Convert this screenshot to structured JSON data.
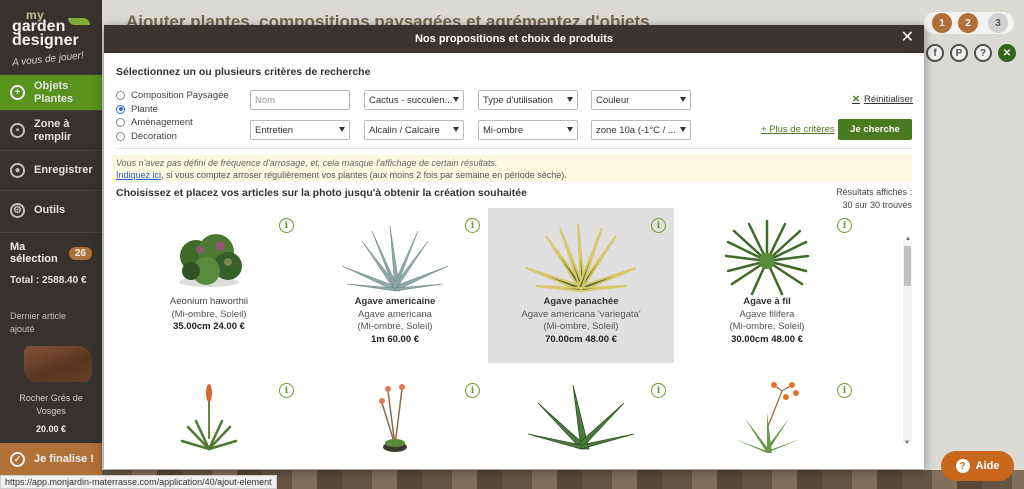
{
  "sidebar": {
    "logo": {
      "line1": "my",
      "line2": "garden",
      "line3": "designer",
      "tagline": "A vous de jouer!"
    },
    "nav": [
      {
        "label": "Objets Plantes",
        "icon": "plus-icon"
      },
      {
        "label": "Zone à remplir",
        "icon": "car-icon"
      },
      {
        "label": "Enregistrer",
        "icon": "save-icon"
      },
      {
        "label": "Outils",
        "icon": "tools-icon"
      }
    ],
    "selection": {
      "label": "Ma sélection",
      "count": "26",
      "total": "Total : 2588.40 €"
    },
    "last_item": {
      "label": "Dernier article ajouté",
      "name": "Rocher Grès de Vosges",
      "price": "20.00 €"
    },
    "finalise": "Je finalise !"
  },
  "page": {
    "title": "Ajouter plantes, compositions paysagées et agrémentez d'objets",
    "steps": [
      "1",
      "2",
      "3"
    ],
    "status_url": "https://app.monjardin-materrasse.com/application/40/ajout-element",
    "aide": "Aide"
  },
  "modal": {
    "title": "Nos propositions et choix de produits",
    "criteria_title": "Sélectionnez un ou plusieurs critères de recherche",
    "radio_options": [
      {
        "label": "Composition Paysagée",
        "checked": false
      },
      {
        "label": "Plante",
        "checked": true
      },
      {
        "label": "Aménagement",
        "checked": false
      },
      {
        "label": "Décoration",
        "checked": false
      }
    ],
    "filters": {
      "nom_placeholder": "Nom",
      "type_plante": "Cactus - succulen...",
      "type_utilisation": "Type d'utilisation",
      "couleur": "Couleur",
      "entretien": "Entretien",
      "sol": "Alcalin / Calcaire",
      "exposition": "Mi-ombre",
      "zone": "zone 10a (-1°C / ..."
    },
    "reset": "Réinitialiser",
    "more_criteria": "+ Plus de critères",
    "search_button": "Je cherche",
    "warning": {
      "line1": "Vous n'avez pas défini de fréquence d'arrosage, et, cela masque l'affichage de certain résultats.",
      "link": "Indiquez ici",
      "line2": ", si vous comptez arroser régulièrement vos plantes (aux moins 2 fois par semaine en période sèche)."
    },
    "choose_title": "Choisissez et placez vos articles sur la photo jusqu'à obtenir la création souhaitée",
    "results": {
      "label": "Résultats affichés :",
      "value": "30 sur 30 trouvés"
    },
    "products": [
      {
        "name": "",
        "latin": "Aeonium haworthii",
        "expo": "(Mi-ombre, Soleil)",
        "price": "35.00cm 24.00 €",
        "selected": false
      },
      {
        "name": "Agave americaine",
        "latin": "Agave americana",
        "expo": "(Mi-ombre, Soleil)",
        "price": "1m 60.00 €",
        "selected": false
      },
      {
        "name": "Agave panachée",
        "latin": "Agave americana 'variegata'",
        "expo": "(Mi-ombre, Soleil)",
        "price": "70.00cm 48.00 €",
        "selected": true
      },
      {
        "name": "Agave à fil",
        "latin": "Agave filifera",
        "expo": "(Mi-ombre, Soleil)",
        "price": "30.00cm 48.00 €",
        "selected": false
      }
    ]
  }
}
